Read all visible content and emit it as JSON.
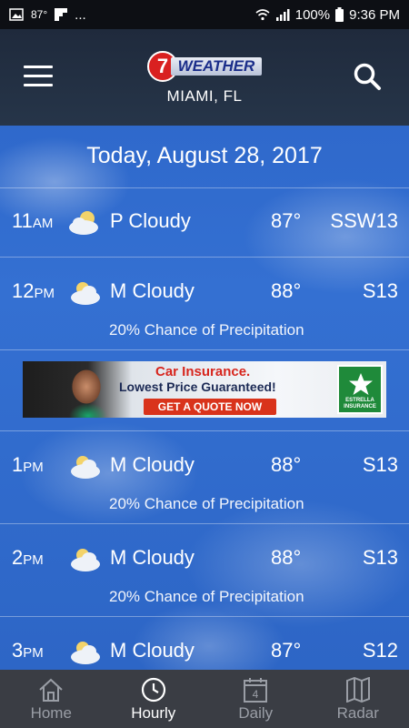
{
  "status_bar": {
    "temp": "87°",
    "dots": "...",
    "battery": "100%",
    "time": "9:36 PM"
  },
  "header": {
    "logo_number": "7",
    "logo_word": "WEATHER",
    "location": "MIAMI, FL"
  },
  "date_label": "Today, August 28, 2017",
  "hours": [
    {
      "hour": "11",
      "ampm": "AM",
      "condition": "P Cloudy",
      "temp": "87°",
      "wind": "SSW13",
      "precip": ""
    },
    {
      "hour": "12",
      "ampm": "PM",
      "condition": "M Cloudy",
      "temp": "88°",
      "wind": "S13",
      "precip": "20% Chance of Precipitation"
    },
    {
      "hour": "1",
      "ampm": "PM",
      "condition": "M Cloudy",
      "temp": "88°",
      "wind": "S13",
      "precip": "20% Chance of Precipitation"
    },
    {
      "hour": "2",
      "ampm": "PM",
      "condition": "M Cloudy",
      "temp": "88°",
      "wind": "S13",
      "precip": "20% Chance of Precipitation"
    },
    {
      "hour": "3",
      "ampm": "PM",
      "condition": "M Cloudy",
      "temp": "87°",
      "wind": "S12",
      "precip": ""
    }
  ],
  "ad": {
    "title": "Car Insurance.",
    "subtitle": "Lowest Price Guaranteed!",
    "cta": "GET A QUOTE NOW",
    "badge": "ESTRELLA INSURANCE"
  },
  "nav": {
    "items": [
      {
        "label": "Home",
        "icon": "home-icon"
      },
      {
        "label": "Hourly",
        "icon": "clock-icon"
      },
      {
        "label": "Daily",
        "icon": "calendar-icon",
        "badge": "4"
      },
      {
        "label": "Radar",
        "icon": "map-icon"
      }
    ],
    "active": "Hourly"
  },
  "colors": {
    "header_bg": "#1f2a3c",
    "sky_blue": "#2b63c6",
    "nav_bg": "#3a3d44",
    "nav_inactive": "#9a9ea6",
    "logo_red": "#d92020"
  }
}
